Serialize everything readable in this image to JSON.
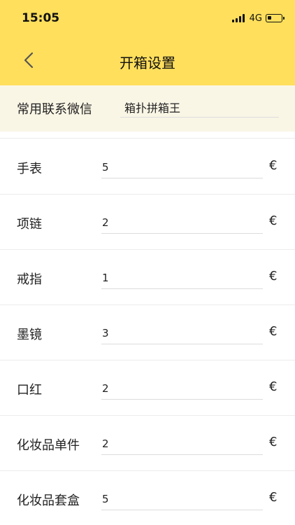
{
  "status_bar": {
    "time": "15:05",
    "network": "4G",
    "battery_level": 0.3
  },
  "nav": {
    "back_icon": "chevron-left-icon",
    "title": "开箱设置"
  },
  "wechat": {
    "label": "常用联系微信",
    "value": "箱扑拼箱王"
  },
  "currency_symbol": "€",
  "items": [
    {
      "label": "手表",
      "value": "5"
    },
    {
      "label": "项链",
      "value": "2"
    },
    {
      "label": "戒指",
      "value": "1"
    },
    {
      "label": "墨镜",
      "value": "3"
    },
    {
      "label": "口红",
      "value": "2"
    },
    {
      "label": "化妆品单件",
      "value": "2"
    },
    {
      "label": "化妆品套盒",
      "value": "5"
    }
  ],
  "colors": {
    "header": "#ffdf5c",
    "wechat_row_bg": "#faf6e6",
    "text": "#222222"
  }
}
